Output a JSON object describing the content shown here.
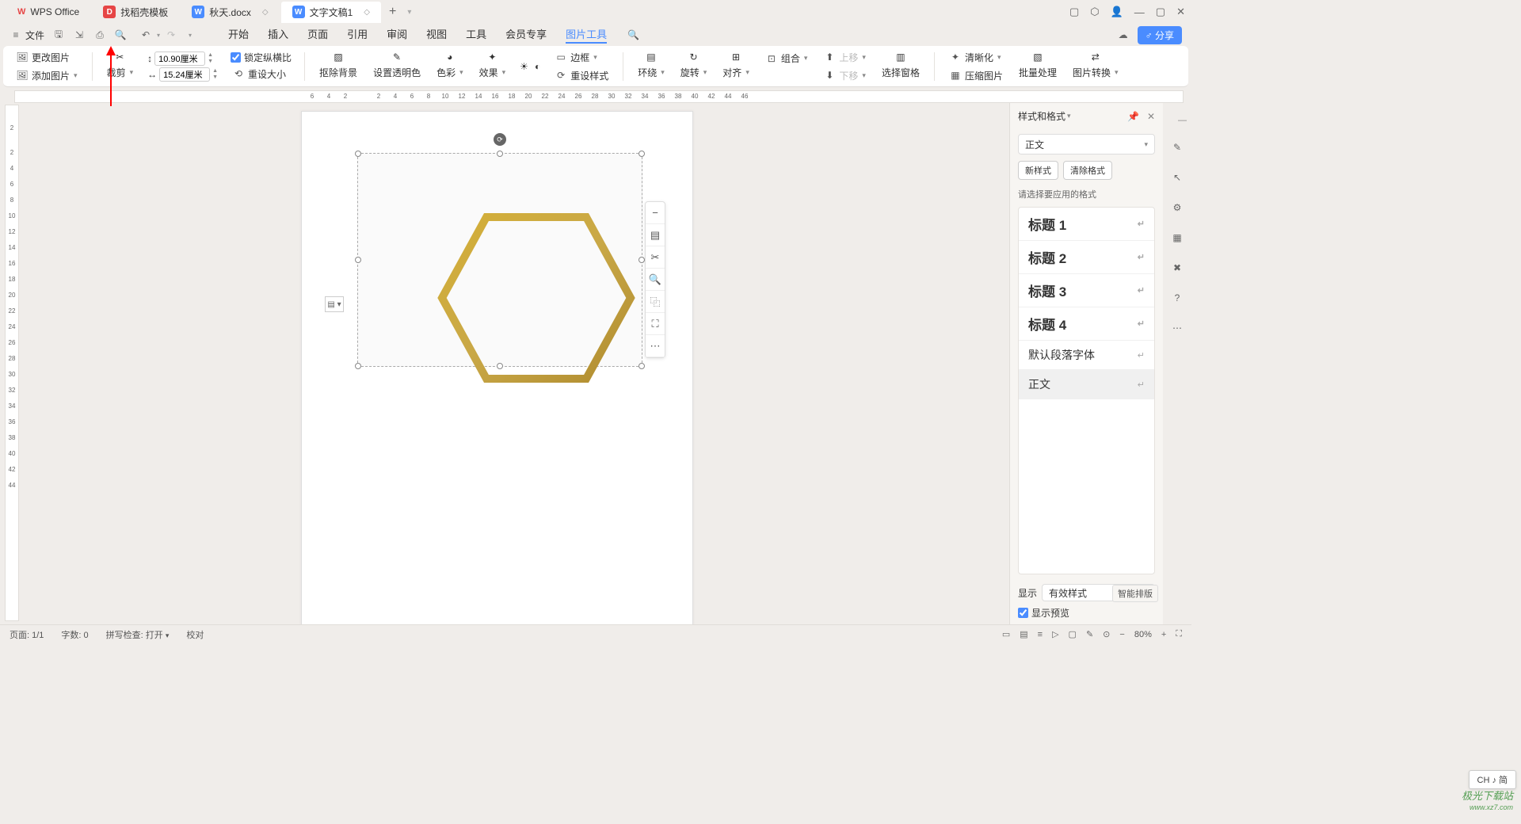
{
  "titlebar": {
    "app_name": "WPS Office",
    "tabs": [
      {
        "label": "找稻壳模板",
        "icon": "red"
      },
      {
        "label": "秋天.docx",
        "icon": "blue"
      },
      {
        "label": "文字文稿1",
        "icon": "blue",
        "active": true
      }
    ]
  },
  "menubar": {
    "file_label": "文件",
    "items": [
      "开始",
      "插入",
      "页面",
      "引用",
      "审阅",
      "视图",
      "工具",
      "会员专享",
      "图片工具"
    ],
    "active_index": 8,
    "share_label": "分享"
  },
  "ribbon": {
    "change_image": "更改图片",
    "add_image": "添加图片",
    "crop": "裁剪",
    "height": "10.90厘米",
    "width": "15.24厘米",
    "lock_ratio": "锁定纵横比",
    "reset_size": "重设大小",
    "remove_bg": "抠除背景",
    "set_transparent": "设置透明色",
    "color": "色彩",
    "effect": "效果",
    "border": "边框",
    "reset_style": "重设样式",
    "wrap": "环绕",
    "rotate": "旋转",
    "align": "对齐",
    "group": "组合",
    "move_up": "上移",
    "move_down": "下移",
    "selection_pane": "选择窗格",
    "clarity": "清晰化",
    "compress": "压缩图片",
    "batch": "批量处理",
    "convert": "图片转换"
  },
  "ruler_h": [
    "6",
    "4",
    "2",
    "",
    "2",
    "4",
    "6",
    "8",
    "10",
    "12",
    "14",
    "16",
    "18",
    "20",
    "22",
    "24",
    "26",
    "28",
    "30",
    "32",
    "34",
    "36",
    "38",
    "40",
    "42",
    "44",
    "46"
  ],
  "ruler_v": [
    "2",
    "",
    "2",
    "4",
    "6",
    "8",
    "10",
    "12",
    "14",
    "16",
    "18",
    "20",
    "22",
    "24",
    "26",
    "28",
    "30",
    "32",
    "34",
    "36",
    "38",
    "40",
    "42",
    "44"
  ],
  "right_panel": {
    "title": "样式和格式",
    "current_style": "正文",
    "new_style": "新样式",
    "clear_format": "清除格式",
    "hint": "请选择要应用的格式",
    "styles": [
      {
        "label": "标题 1",
        "heading": true
      },
      {
        "label": "标题 2",
        "heading": true
      },
      {
        "label": "标题 3",
        "heading": true
      },
      {
        "label": "标题 4",
        "heading": true
      },
      {
        "label": "默认段落字体",
        "heading": false
      },
      {
        "label": "正文",
        "heading": false,
        "selected": true
      }
    ],
    "show_label": "显示",
    "show_value": "有效样式",
    "preview_label": "显示预览",
    "smart_layout": "智能排版"
  },
  "statusbar": {
    "page": "页面: 1/1",
    "words": "字数: 0",
    "spellcheck": "拼写检查: 打开",
    "proof": "校对",
    "zoom": "80%"
  },
  "ime": "CH ♪ 简",
  "watermark": {
    "line1": "极光下载站",
    "line2": "www.xz7.com"
  }
}
